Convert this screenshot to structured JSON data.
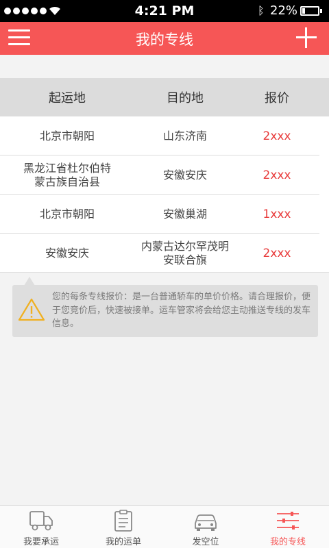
{
  "status_bar": {
    "time": "4:21 PM",
    "battery_percent": "22%",
    "battery_level": 0.22,
    "icons": [
      "signal-dots-icon",
      "wifi-icon",
      "bluetooth-icon",
      "battery-icon"
    ]
  },
  "nav": {
    "title": "我的专线",
    "left_icon": "menu-icon",
    "right_icon": "plus-icon",
    "accent_color": "#f65656"
  },
  "table": {
    "columns": [
      "起运地",
      "目的地",
      "报价"
    ],
    "rows": [
      {
        "origin": "北京市朝阳",
        "destination": "山东济南",
        "price": "2xxx"
      },
      {
        "origin": "黑龙江省杜尔伯特\n蒙古族自治县",
        "destination": "安徽安庆",
        "price": "2xxx"
      },
      {
        "origin": "北京市朝阳",
        "destination": "安徽巢湖",
        "price": "1xxx"
      },
      {
        "origin": "安徽安庆",
        "destination": "内蒙古达尔罕茂明\n安联合旗",
        "price": "2xxx"
      }
    ],
    "price_color": "#e83a3a"
  },
  "notice": {
    "icon": "warning-icon",
    "text": "您的每条专线报价：是一台普通轿车的单价价格。请合理报价，便于您竞价后，快速被接单。运车管家将会给您主动推送专线的发车信息。"
  },
  "tab_bar": {
    "tabs": [
      {
        "label": "我要承运",
        "icon": "truck-icon",
        "active": false
      },
      {
        "label": "我的运单",
        "icon": "document-icon",
        "active": false
      },
      {
        "label": "发空位",
        "icon": "car-icon",
        "active": false
      },
      {
        "label": "我的专线",
        "icon": "sliders-icon",
        "active": true
      }
    ]
  }
}
